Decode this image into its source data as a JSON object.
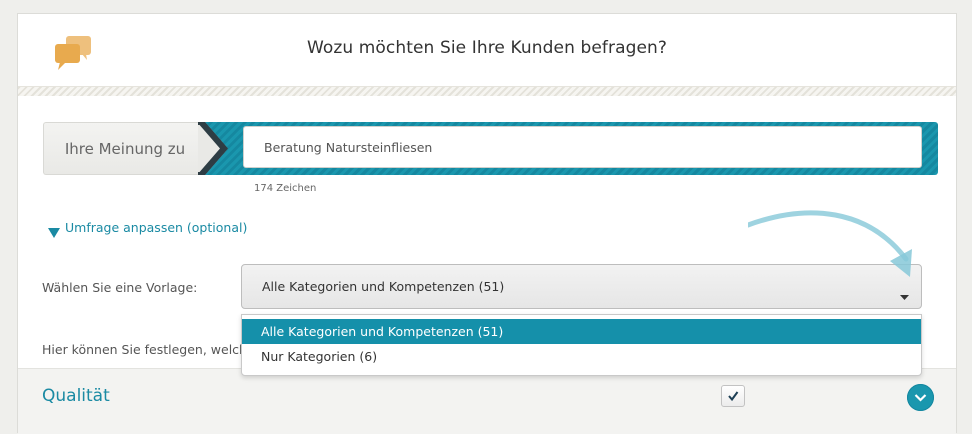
{
  "header": {
    "title": "Wozu möchten Sie Ihre Kunden befragen?",
    "icon": "chat-bubbles-icon",
    "icon_color": "#e8aa4e"
  },
  "topic": {
    "label": "Ihre Meinung zu",
    "value": "Beratung Natursteinfliesen",
    "char_count": "174 Zeichen"
  },
  "customize": {
    "label": "Umfrage anpassen (optional)"
  },
  "template": {
    "label": "Wählen Sie eine Vorlage:",
    "selected": "Alle Kategorien und Kompetenzen (51)",
    "options": [
      "Alle Kategorien und Kompetenzen (51)",
      "Nur Kategorien (6)"
    ]
  },
  "hint": {
    "text": "Hier können Sie festlegen, welche"
  },
  "section": {
    "title": "Qualität",
    "checked": true
  },
  "colors": {
    "accent": "#1a97ae",
    "accent_text": "#1a8aa3",
    "highlight": "#1590aa",
    "icon_orange": "#e8aa4e",
    "arrow": "#7fc6d6"
  }
}
